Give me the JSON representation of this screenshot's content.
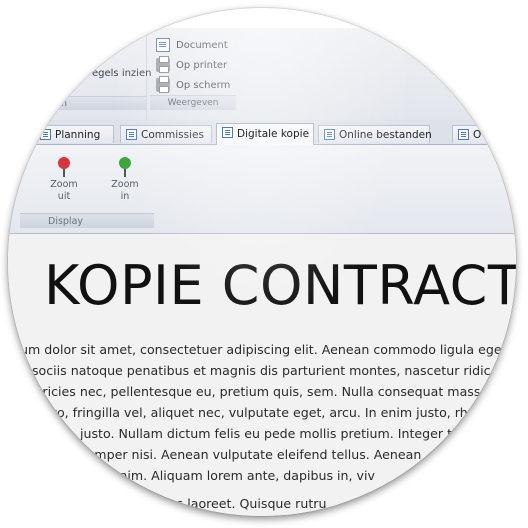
{
  "ribbon_groups": {
    "left_group": {
      "command_label": "egels inzien",
      "footer_label": "gen"
    },
    "output_group": {
      "commands": [
        "Document",
        "Op printer",
        "Op scherm"
      ],
      "footer_label": "Weergeven"
    }
  },
  "tabs": [
    {
      "label": "Planning"
    },
    {
      "label": "Commissies"
    },
    {
      "label": "Digitale kopie"
    },
    {
      "label": "Online bestanden"
    },
    {
      "label": "O"
    }
  ],
  "display_group": {
    "zoom_out": {
      "line1": "Zoom",
      "line2": "uit",
      "color": "#d9343a"
    },
    "zoom_in": {
      "line1": "Zoom",
      "line2": "in",
      "color": "#3aa63a"
    },
    "footer_label": "Display"
  },
  "document": {
    "title": "KOPIE CONTRACT",
    "lines": [
      "um dolor sit amet, consectetuer adipiscing elit. Aenean commodo ligula eget",
      "n sociis natoque penatibus et magnis dis parturient montes, nascetur ridic",
      "ultricies nec, pellentesque eu, pretium quis, sem. Nulla consequat massa",
      "to, fringilla vel, aliquet nec, vulputate eget, arcu. In enim justo, rh",
      "justo. Nullam dictum felis eu pede mollis pretium. Integer ti",
      "semper nisi. Aenean vulputate eleifend tellus. Aenean",
      "Lac, enim. Aliquam lorem ante, dapibus in, viv",
      "rius laoreet. Quisque rutru"
    ]
  }
}
